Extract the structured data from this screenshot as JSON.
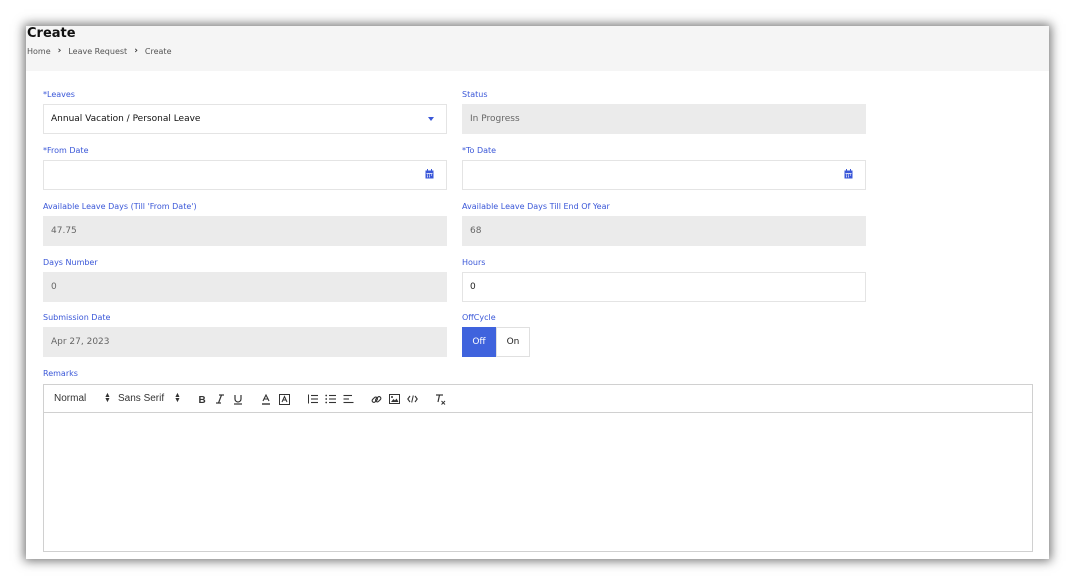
{
  "header": {
    "title": "Create",
    "breadcrumb": [
      "Home",
      "Leave Request",
      "Create"
    ]
  },
  "form": {
    "leaves": {
      "label": "*Leaves",
      "value": "Annual Vacation / Personal Leave"
    },
    "status": {
      "label": "Status",
      "value": "In Progress"
    },
    "from_date": {
      "label": "*From Date",
      "value": ""
    },
    "to_date": {
      "label": "*To Date",
      "value": ""
    },
    "available_till_from": {
      "label": "Available Leave Days (Till 'From Date')",
      "value": "47.75"
    },
    "available_till_end": {
      "label": "Available Leave Days Till End Of Year",
      "value": "68"
    },
    "days_number": {
      "label": "Days Number",
      "value": "0"
    },
    "hours": {
      "label": "Hours",
      "value": "0"
    },
    "submission_date": {
      "label": "Submission Date",
      "value": "Apr 27, 2023"
    },
    "offcycle": {
      "label": "OffCycle",
      "options": [
        "Off",
        "On"
      ],
      "selected": "Off"
    },
    "remarks": {
      "label": "Remarks",
      "value": ""
    }
  },
  "editor": {
    "header_select": "Normal",
    "font_select": "Sans Serif",
    "buttons": [
      "bold",
      "italic",
      "underline",
      "text-color",
      "background-color",
      "ordered-list",
      "bullet-list",
      "align",
      "link",
      "image",
      "code",
      "clear-format"
    ]
  },
  "colors": {
    "accent": "#3a57d8",
    "toggle_active": "#3f63dd",
    "readonly_bg": "#ebebeb",
    "header_bg": "#f5f5f5"
  }
}
